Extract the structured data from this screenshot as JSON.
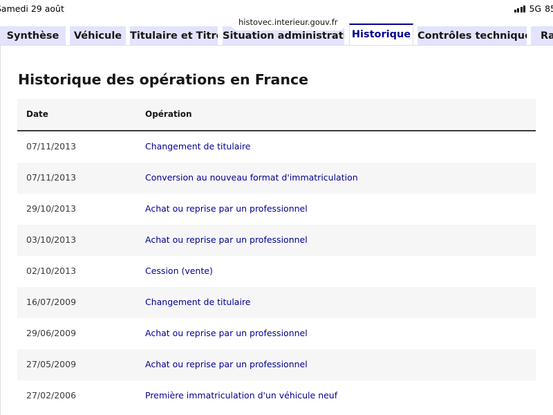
{
  "statusbar": {
    "date": "Samedi 29 août",
    "network": "5G",
    "battery": "85"
  },
  "browser": {
    "url": "histovec.interieur.gouv.fr"
  },
  "tabs": [
    {
      "label": "Synthèse"
    },
    {
      "label": "Véhicule"
    },
    {
      "label": "Titulaire et Titre"
    },
    {
      "label": "Situation administrative"
    },
    {
      "label": "Historique",
      "active": true
    },
    {
      "label": "Contrôles techniques"
    },
    {
      "label": "Rapport"
    }
  ],
  "main": {
    "title": "Historique des opérations en France",
    "table": {
      "headers": {
        "date": "Date",
        "operation": "Opération"
      },
      "rows": [
        {
          "date": "07/11/2013",
          "operation": "Changement de titulaire"
        },
        {
          "date": "07/11/2013",
          "operation": "Conversion au nouveau format d'immatriculation"
        },
        {
          "date": "29/10/2013",
          "operation": "Achat ou reprise par un professionnel"
        },
        {
          "date": "03/10/2013",
          "operation": "Achat ou reprise par un professionnel"
        },
        {
          "date": "02/10/2013",
          "operation": "Cession (vente)"
        },
        {
          "date": "16/07/2009",
          "operation": "Changement de titulaire"
        },
        {
          "date": "29/06/2009",
          "operation": "Achat ou reprise par un professionnel"
        },
        {
          "date": "27/05/2009",
          "operation": "Achat ou reprise par un professionnel"
        },
        {
          "date": "27/02/2006",
          "operation": "Première immatriculation d'un véhicule neuf"
        }
      ]
    }
  },
  "colors": {
    "accent": "#000091",
    "tab_background": "#e3e3fd",
    "row_alt": "#f6f6f6"
  },
  "icons": [
    "signal-icon"
  ]
}
